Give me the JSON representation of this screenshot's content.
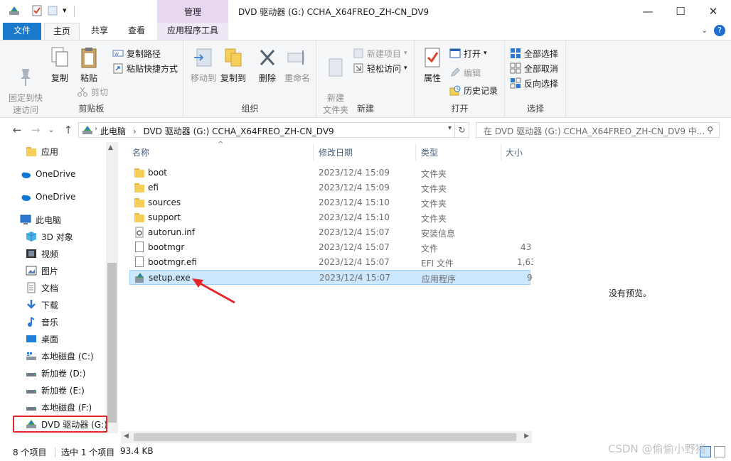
{
  "window": {
    "title": "DVD 驱动器 (G:) CCHA_X64FREO_ZH-CN_DV9",
    "context_group": "管理",
    "controls": {
      "minimize": "—",
      "maximize": "☐",
      "close": "✕"
    }
  },
  "quick_access": {
    "dropdown": "▾"
  },
  "tabs": [
    {
      "label": "文件"
    },
    {
      "label": "主页"
    },
    {
      "label": "共享"
    },
    {
      "label": "查看"
    },
    {
      "label": "应用程序工具"
    }
  ],
  "ribbon": {
    "clipboard": {
      "label": "剪贴板",
      "pin": "固定到快\n速访问",
      "copy": "复制",
      "paste": "粘贴",
      "copy_path": "复制路径",
      "paste_shortcut": "粘贴快捷方式",
      "cut": "剪切"
    },
    "organize": {
      "label": "组织",
      "move_to": "移动到",
      "copy_to": "复制到",
      "delete": "删除",
      "rename": "重命名"
    },
    "new": {
      "label": "新建",
      "new_folder": "新建\n文件夹",
      "new_item": "新建项目",
      "easy_access": "轻松访问"
    },
    "open": {
      "label": "打开",
      "properties": "属性",
      "open": "打开",
      "edit": "编辑",
      "history": "历史记录"
    },
    "select": {
      "label": "选择",
      "select_all": "全部选择",
      "select_none": "全部取消",
      "invert": "反向选择"
    }
  },
  "nav": {
    "back": "←",
    "forward": "→",
    "recent": "⌄",
    "up": "↑",
    "breadcrumb": [
      "此电脑",
      "DVD 驱动器 (G:) CCHA_X64FREO_ZH-CN_DV9"
    ],
    "refresh": "↻",
    "search_placeholder": "在 DVD 驱动器 (G:) CCHA_X64FREO_ZH-CN_DV9 中..."
  },
  "navpane": {
    "items": [
      {
        "label": "应用",
        "icon": "folder-icon"
      },
      {
        "label": "OneDrive",
        "icon": "cloud-icon"
      },
      {
        "label": "OneDrive",
        "icon": "cloud-icon"
      },
      {
        "label": "此电脑",
        "icon": "computer-icon"
      },
      {
        "label": "3D 对象",
        "icon": "cube-icon"
      },
      {
        "label": "视频",
        "icon": "video-icon"
      },
      {
        "label": "图片",
        "icon": "picture-icon"
      },
      {
        "label": "文档",
        "icon": "document-icon"
      },
      {
        "label": "下载",
        "icon": "download-icon"
      },
      {
        "label": "音乐",
        "icon": "music-icon"
      },
      {
        "label": "桌面",
        "icon": "desktop-icon"
      },
      {
        "label": "本地磁盘 (C:)",
        "icon": "drive-icon"
      },
      {
        "label": "新加卷 (D:)",
        "icon": "drive-icon"
      },
      {
        "label": "新加卷 (E:)",
        "icon": "drive-icon"
      },
      {
        "label": "本地磁盘 (F:)",
        "icon": "drive-icon"
      },
      {
        "label": "DVD 驱动器 (G:)",
        "icon": "dvd-icon"
      }
    ]
  },
  "files": {
    "columns": {
      "name": "名称",
      "date": "修改日期",
      "type": "类型",
      "size": "大小"
    },
    "rows": [
      {
        "name": "boot",
        "date": "2023/12/4 15:09",
        "type": "文件夹",
        "size": "",
        "icon": "folder-icon"
      },
      {
        "name": "efi",
        "date": "2023/12/4 15:09",
        "type": "文件夹",
        "size": "",
        "icon": "folder-icon"
      },
      {
        "name": "sources",
        "date": "2023/12/4 15:10",
        "type": "文件夹",
        "size": "",
        "icon": "folder-icon"
      },
      {
        "name": "support",
        "date": "2023/12/4 15:10",
        "type": "文件夹",
        "size": "",
        "icon": "folder-icon"
      },
      {
        "name": "autorun.inf",
        "date": "2023/12/4 15:07",
        "type": "安装信息",
        "size": "",
        "icon": "settings-file-icon"
      },
      {
        "name": "bootmgr",
        "date": "2023/12/4 15:07",
        "type": "文件",
        "size": "43",
        "icon": "file-icon"
      },
      {
        "name": "bootmgr.efi",
        "date": "2023/12/4 15:07",
        "type": "EFI 文件",
        "size": "1,63",
        "icon": "file-icon"
      },
      {
        "name": "setup.exe",
        "date": "2023/12/4 15:07",
        "type": "应用程序",
        "size": "9",
        "icon": "setup-app-icon"
      }
    ]
  },
  "preview": {
    "empty_text": "没有预览。"
  },
  "status": {
    "item_count": "8 个项目",
    "selection": "选中 1 个项目",
    "selection_size": "93.4 KB"
  },
  "watermark": "CSDN @偷偷小野猪"
}
